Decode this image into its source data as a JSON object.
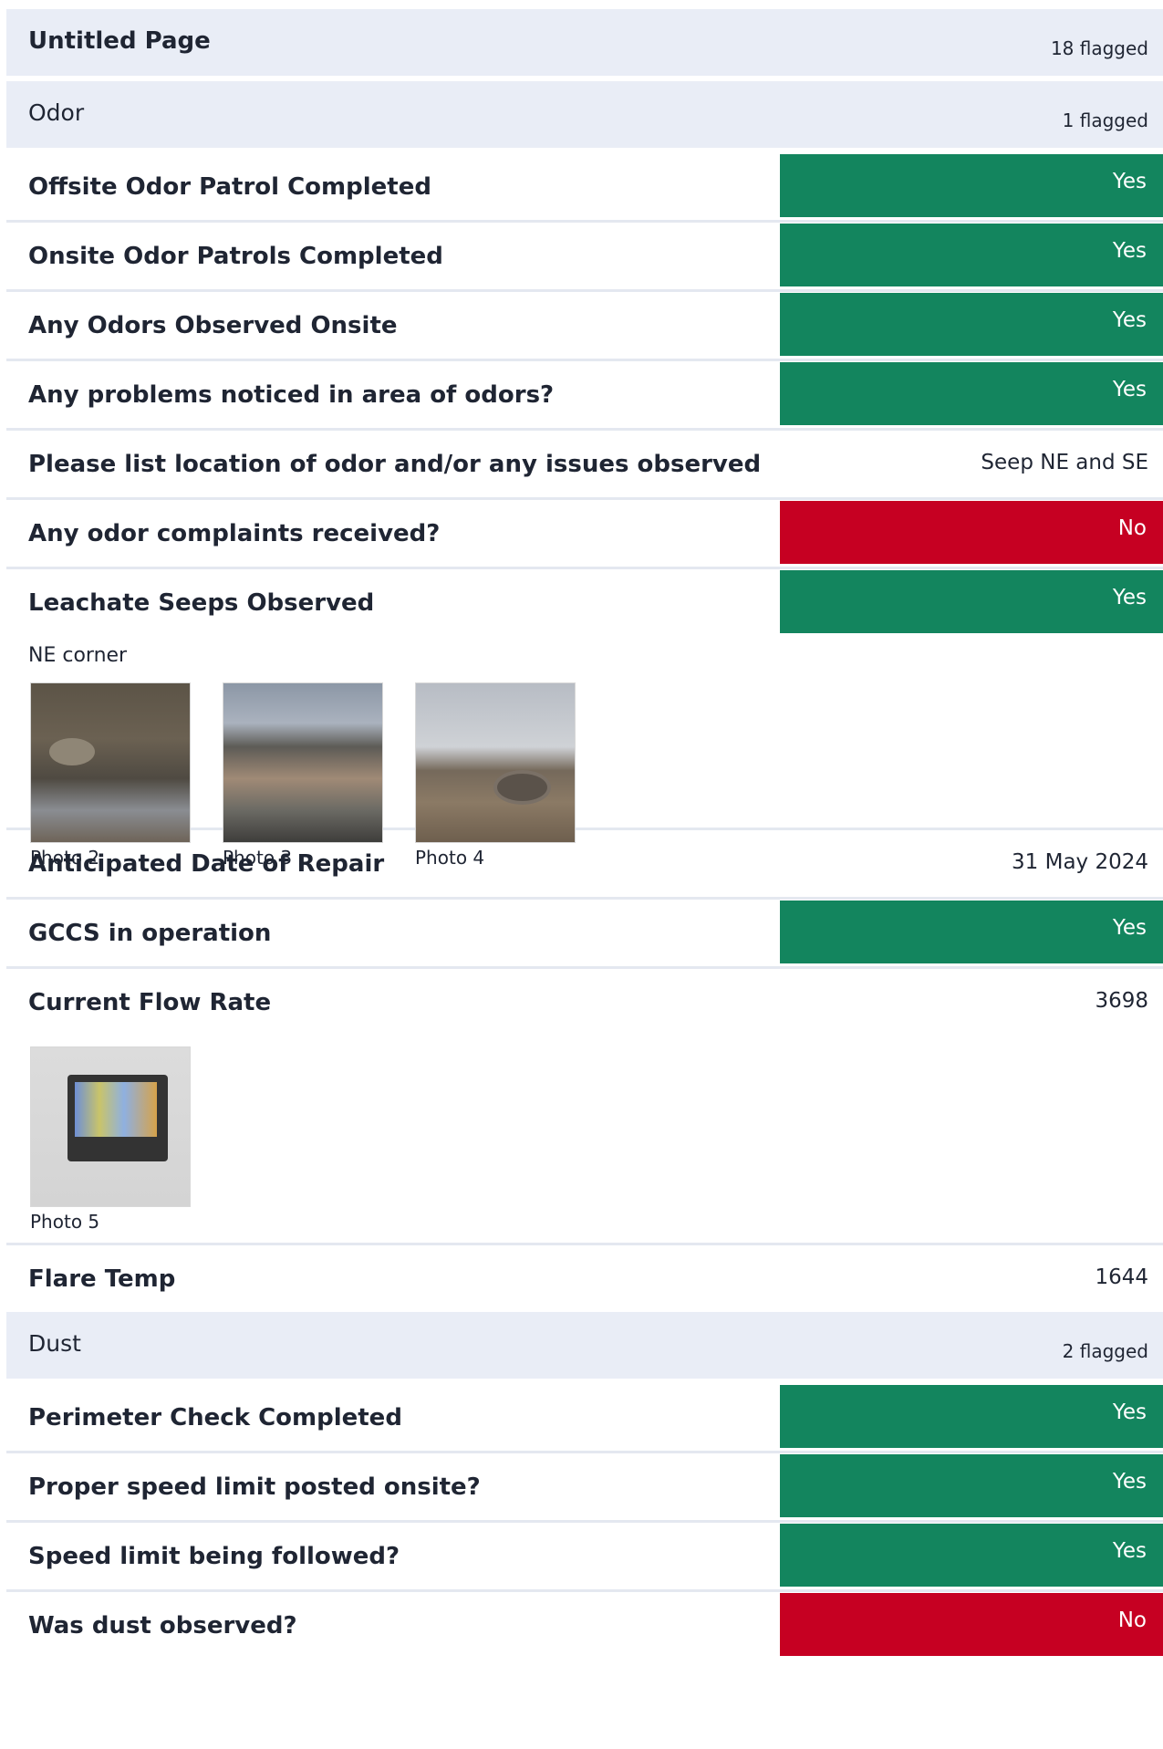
{
  "page": {
    "title": "Untitled Page",
    "flag": "18 flagged"
  },
  "odor": {
    "title": "Odor",
    "flag": "1 flagged",
    "q1": {
      "label": "Offsite Odor Patrol Completed",
      "answer": "Yes"
    },
    "q2": {
      "label": "Onsite Odor Patrols Completed",
      "answer": "Yes"
    },
    "q3": {
      "label": "Any Odors Observed Onsite",
      "answer": "Yes"
    },
    "q4": {
      "label": "Any problems noticed in area of odors?",
      "answer": "Yes"
    },
    "q5": {
      "label": "Please list location of odor and/or any issues observed",
      "value": "Seep NE and SE"
    },
    "q6": {
      "label": "Any odor complaints received?",
      "answer": "No"
    },
    "q7": {
      "label": "Leachate Seeps Observed",
      "answer": "Yes",
      "note": "NE corner",
      "photos": [
        "Photo 2",
        "Photo 3",
        "Photo 4"
      ]
    },
    "q8": {
      "label": "Anticipated Date of Repair",
      "value": "31 May 2024"
    },
    "q9": {
      "label": "GCCS in operation",
      "answer": "Yes"
    },
    "q10": {
      "label": "Current Flow Rate",
      "value": "3698",
      "photos": [
        "Photo 5"
      ]
    },
    "q11": {
      "label": "Flare Temp",
      "value": "1644"
    }
  },
  "dust": {
    "title": "Dust",
    "flag": "2 flagged",
    "q1": {
      "label": "Perimeter Check Completed",
      "answer": "Yes"
    },
    "q2": {
      "label": "Proper speed limit posted onsite?",
      "answer": "Yes"
    },
    "q3": {
      "label": "Speed limit being followed?",
      "answer": "Yes"
    },
    "q4": {
      "label": "Was dust observed?",
      "answer": "No"
    }
  },
  "colors": {
    "yes": "#13855e",
    "no": "#c60022",
    "header_bg": "#e9edf6"
  }
}
